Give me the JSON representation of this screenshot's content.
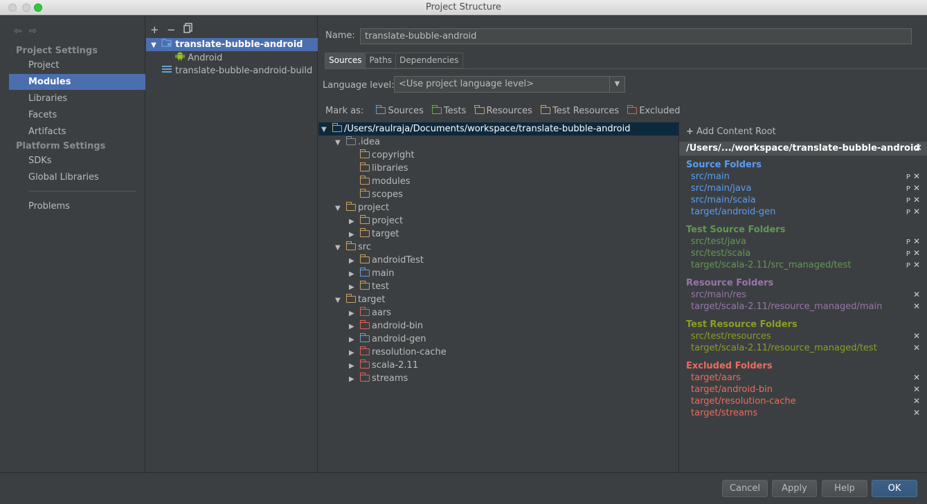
{
  "window": {
    "title": "Project Structure"
  },
  "nav": {
    "groups": {
      "project_settings": "Project Settings",
      "platform_settings": "Platform Settings"
    },
    "items": {
      "project": "Project",
      "modules": "Modules",
      "libraries": "Libraries",
      "facets": "Facets",
      "artifacts": "Artifacts",
      "sdks": "SDKs",
      "global_libraries": "Global Libraries",
      "problems": "Problems"
    },
    "selected": "Modules"
  },
  "module_tree": {
    "tools": {
      "add": "+",
      "remove": "−",
      "copy": "copy-icon"
    },
    "items": [
      {
        "label": "translate-bubble-android",
        "icon": "module-folder-icon",
        "selected": true
      },
      {
        "label": "Android",
        "icon": "android-icon"
      },
      {
        "label": "translate-bubble-android-build",
        "icon": "module-lines-icon"
      }
    ]
  },
  "main": {
    "name_label": "Name:",
    "name_value": "translate-bubble-android",
    "tabs": [
      "Sources",
      "Paths",
      "Dependencies"
    ],
    "active_tab": "Sources",
    "language_label": "Language level:",
    "language_value": "<Use project language level>",
    "mark_as_label": "Mark as:",
    "mark_as": [
      {
        "label": "Sources",
        "color": "#6a9fd4"
      },
      {
        "label": "Tests",
        "color": "#62b543"
      },
      {
        "label": "Resources",
        "color": "#c9a25e"
      },
      {
        "label": "Test Resources",
        "color": "#c9a25e"
      },
      {
        "label": "Excluded",
        "color": "#e0605a"
      }
    ]
  },
  "content_tree": [
    {
      "label": "/Users/raulraja/Documents/workspace/translate-bubble-android",
      "depth": 0,
      "arrow": "▼",
      "color": "#c9a25e",
      "selected": true
    },
    {
      "label": ".idea",
      "depth": 1,
      "arrow": "▼",
      "color": "#8c8c8c"
    },
    {
      "label": "copyright",
      "depth": 2,
      "arrow": "",
      "color": "#c9a25e"
    },
    {
      "label": "libraries",
      "depth": 2,
      "arrow": "",
      "color": "#c9a25e"
    },
    {
      "label": "modules",
      "depth": 2,
      "arrow": "",
      "color": "#c9a25e"
    },
    {
      "label": "scopes",
      "depth": 2,
      "arrow": "",
      "color": "#c9a25e"
    },
    {
      "label": "project",
      "depth": 1,
      "arrow": "▼",
      "color": "#c9a25e"
    },
    {
      "label": "project",
      "depth": 2,
      "arrow": "▶",
      "color": "#c9a25e"
    },
    {
      "label": "target",
      "depth": 2,
      "arrow": "▶",
      "color": "#c9a25e"
    },
    {
      "label": "src",
      "depth": 1,
      "arrow": "▼",
      "color": "#c9a25e"
    },
    {
      "label": "androidTest",
      "depth": 2,
      "arrow": "▶",
      "color": "#c9a25e"
    },
    {
      "label": "main",
      "depth": 2,
      "arrow": "▶",
      "color": "#6a9fd4"
    },
    {
      "label": "test",
      "depth": 2,
      "arrow": "▶",
      "color": "#c9a25e"
    },
    {
      "label": "target",
      "depth": 1,
      "arrow": "▼",
      "color": "#c9a25e"
    },
    {
      "label": "aars",
      "depth": 2,
      "arrow": "▶",
      "color": "#e0605a"
    },
    {
      "label": "android-bin",
      "depth": 2,
      "arrow": "▶",
      "color": "#e0605a"
    },
    {
      "label": "android-gen",
      "depth": 2,
      "arrow": "▶",
      "color": "#6a9fd4"
    },
    {
      "label": "resolution-cache",
      "depth": 2,
      "arrow": "▶",
      "color": "#e0605a"
    },
    {
      "label": "scala-2.11",
      "depth": 2,
      "arrow": "▶",
      "color": "#e0605a"
    },
    {
      "label": "streams",
      "depth": 2,
      "arrow": "▶",
      "color": "#e0605a"
    }
  ],
  "roots": {
    "add_label": "Add Content Root",
    "root_path": "/Users/.../workspace/translate-bubble-android",
    "sections": [
      {
        "title": "Source Folders",
        "color": "#589df6",
        "items": [
          "src/main",
          "src/main/java",
          "src/main/scala",
          "target/android-gen"
        ],
        "editable": true
      },
      {
        "title": "Test Source Folders",
        "color": "#629755",
        "items": [
          "src/test/java",
          "src/test/scala",
          "target/scala-2.11/src_managed/test"
        ],
        "editable": true
      },
      {
        "title": "Resource Folders",
        "color": "#9876aa",
        "items": [
          "src/main/res",
          "target/scala-2.11/resource_managed/main"
        ],
        "editable": false
      },
      {
        "title": "Test Resource Folders",
        "color": "#8c9f23",
        "items": [
          "src/test/resources",
          "target/scala-2.11/resource_managed/test"
        ],
        "editable": false
      },
      {
        "title": "Excluded Folders",
        "color": "#ea6c5f",
        "items": [
          "target/aars",
          "target/android-bin",
          "target/resolution-cache",
          "target/streams"
        ],
        "editable": false
      }
    ]
  },
  "buttons": {
    "cancel": "Cancel",
    "apply": "Apply",
    "help": "Help",
    "ok": "OK"
  }
}
